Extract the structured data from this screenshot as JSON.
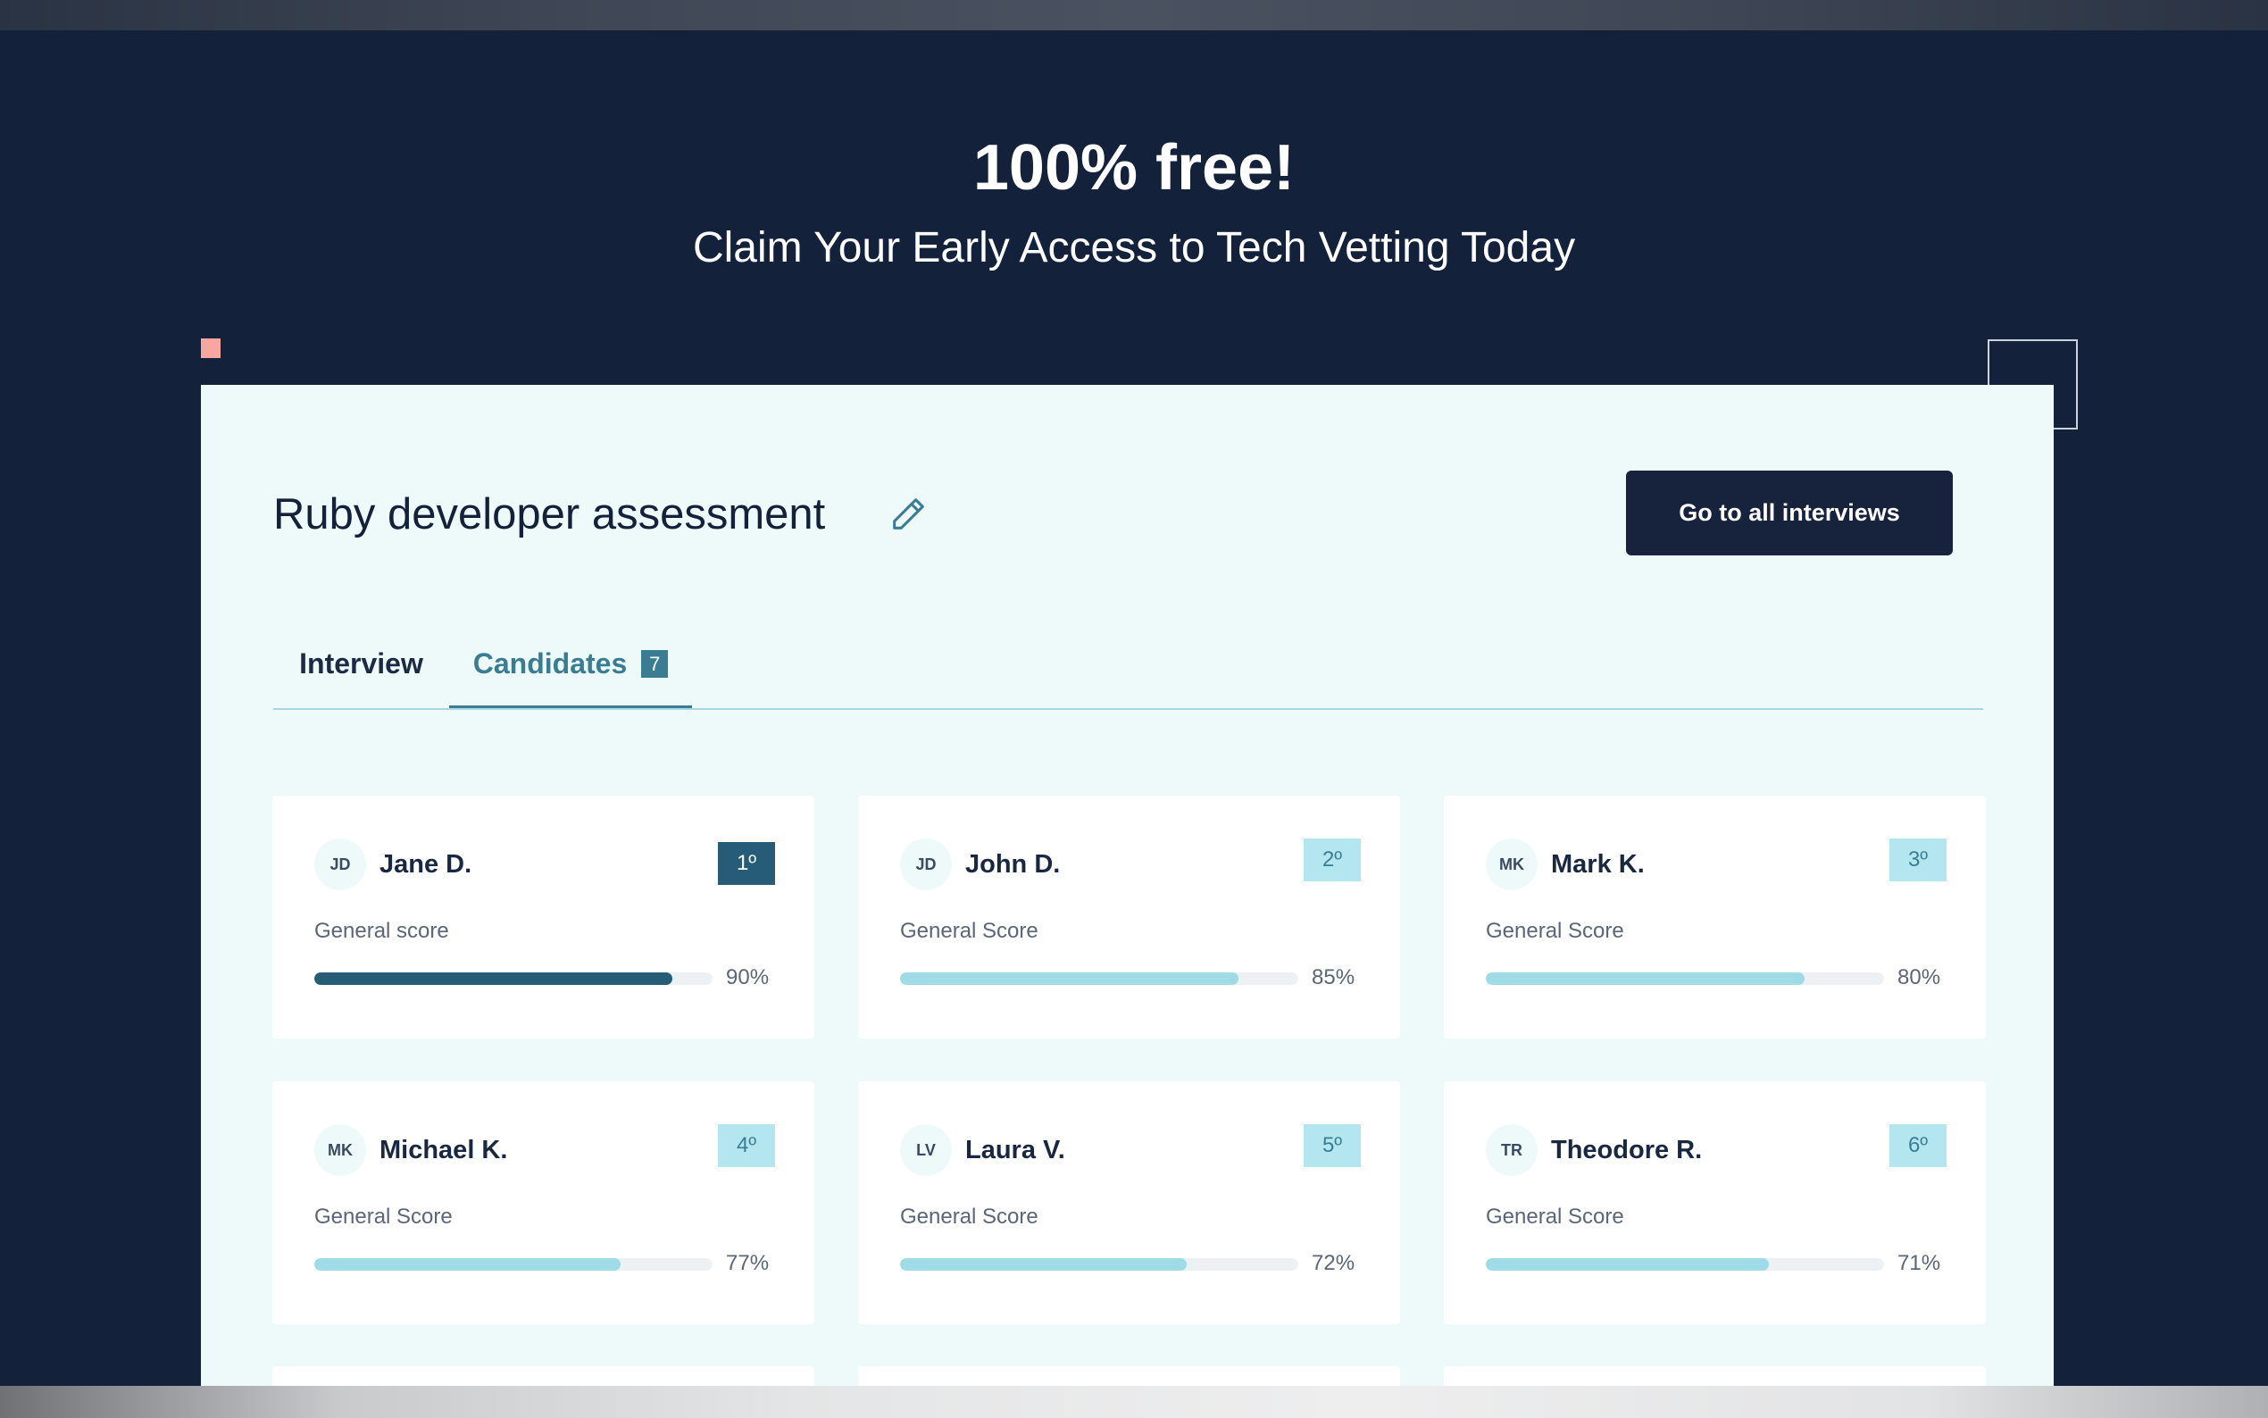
{
  "hero": {
    "title": "100% free!",
    "subtitle": "Claim Your Early Access to Tech Vetting Today"
  },
  "panel": {
    "title": "Ruby developer assessment",
    "edit_icon": "pencil-icon",
    "cta_label": "Go to all interviews"
  },
  "tabs": {
    "interview_label": "Interview",
    "candidates_label": "Candidates",
    "candidates_count": "7",
    "active": "Candidates"
  },
  "colors": {
    "background": "#13213b",
    "panel": "#eef9f9",
    "accent": "#3a7d92",
    "top_rank": "#265c77",
    "bar_fill": "#9edbe6",
    "deco_square": "#f7a6a0"
  },
  "candidates": [
    {
      "initials": "JD",
      "name": "Jane D.",
      "rank": "1º",
      "score_label": "General score",
      "score_text": "90%",
      "score": 90
    },
    {
      "initials": "JD",
      "name": "John D.",
      "rank": "2º",
      "score_label": "General Score",
      "score_text": "85%",
      "score": 85
    },
    {
      "initials": "MK",
      "name": "Mark K.",
      "rank": "3º",
      "score_label": "General Score",
      "score_text": "80%",
      "score": 80
    },
    {
      "initials": "MK",
      "name": "Michael K.",
      "rank": "4º",
      "score_label": "General Score",
      "score_text": "77%",
      "score": 77
    },
    {
      "initials": "LV",
      "name": "Laura V.",
      "rank": "5º",
      "score_label": "General Score",
      "score_text": "72%",
      "score": 72
    },
    {
      "initials": "TR",
      "name": "Theodore R.",
      "rank": "6º",
      "score_label": "General Score",
      "score_text": "71%",
      "score": 71
    }
  ]
}
